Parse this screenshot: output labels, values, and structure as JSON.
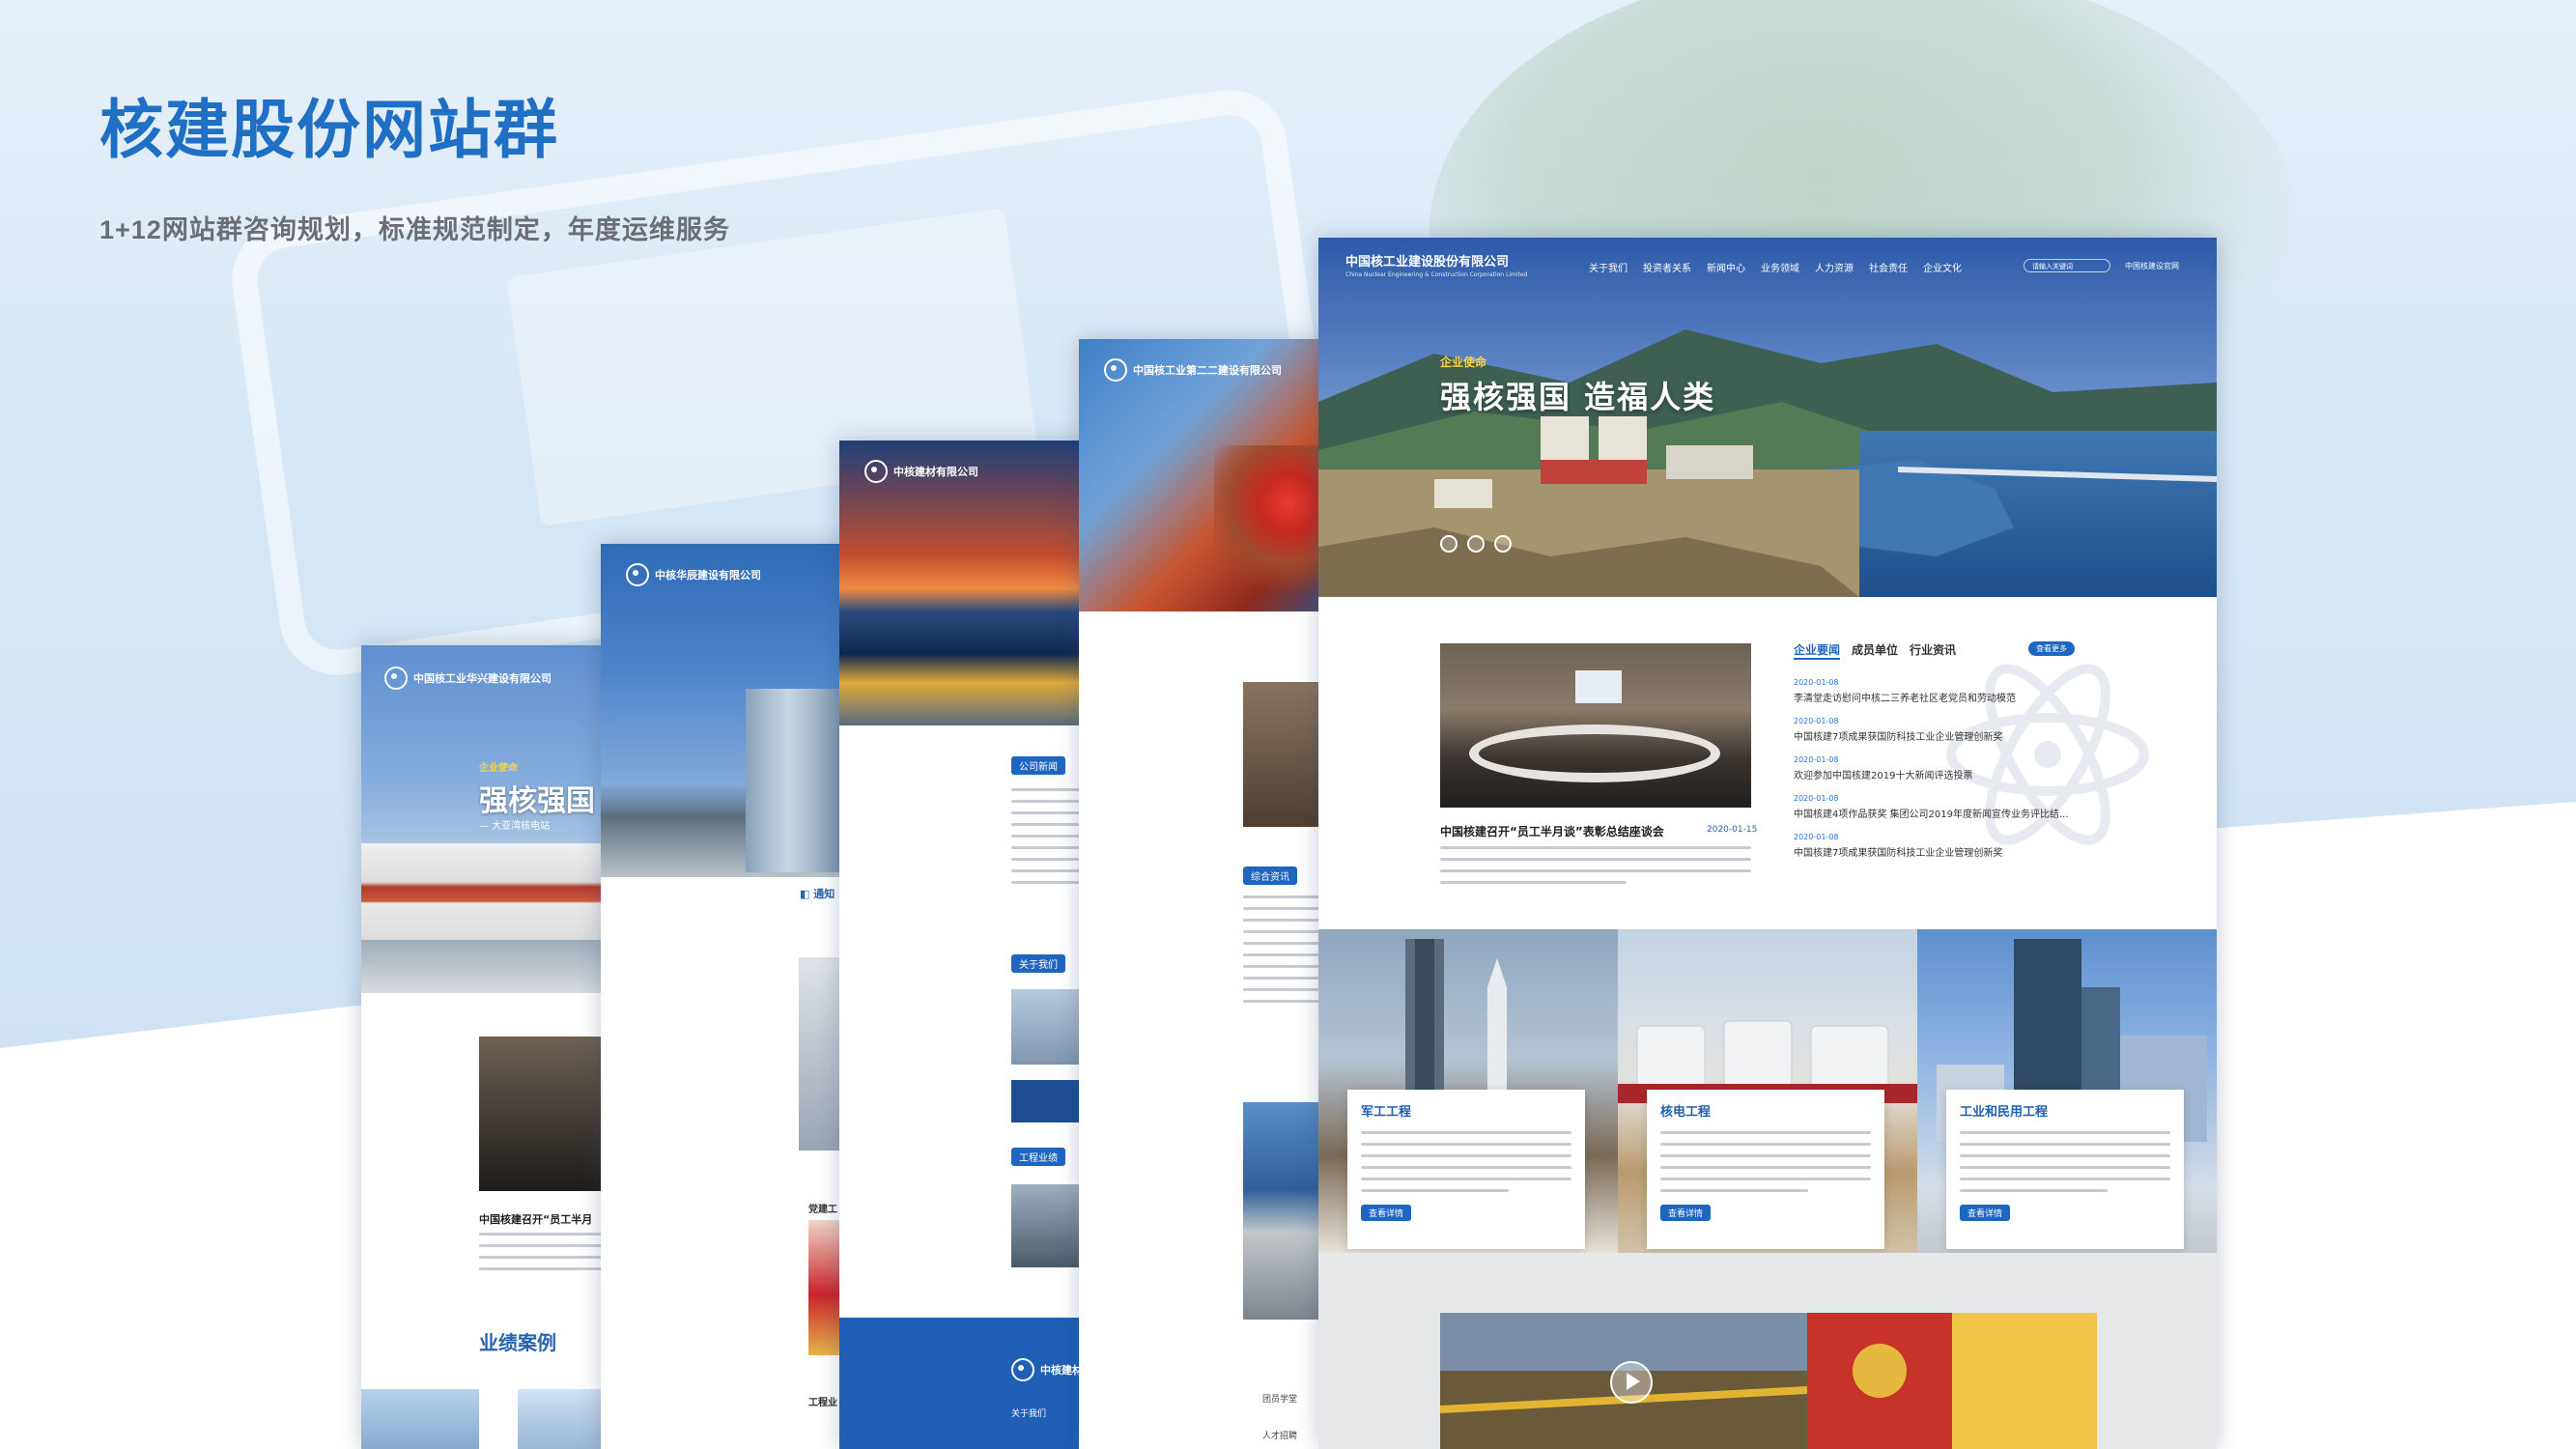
{
  "page": {
    "title": "核建股份网站群",
    "subtitle": "1+12网站群咨询规划，标准规范制定，年度运维服务"
  },
  "sites": {
    "s1": {
      "logo": "中国核工业华兴建设有限公司",
      "slogan_tag": "企业使命",
      "slogan": "强核强国",
      "caption": "— 大亚湾核电站",
      "news_headline": "中国核建召开“员工半月",
      "section_heading": "业绩案例"
    },
    "s2": {
      "logo": "中核华辰建设有限公司",
      "quick_link": "通知",
      "party_label": "党建工",
      "sub_label": "工程业"
    },
    "s3": {
      "logo": "中核建材有限公司",
      "tab_company_news": "公司新闻",
      "tab_about": "关于我们",
      "tab_projects": "工程业绩",
      "footer_logo": "中核建材",
      "footer_about": "关于我们"
    },
    "s4": {
      "logo": "中国核工业第二二建设有限公司",
      "tab_integrated": "综合资讯",
      "footer_item_1": "团员学堂",
      "footer_item_2": "人才招聘"
    },
    "s5": {
      "logo": "中国核工业建设股份有限公司",
      "logo_sub": "China Nuclear Engineering & Construction Corporation Limited",
      "nav": [
        "关于我们",
        "投资者关系",
        "新闻中心",
        "业务领域",
        "人力资源",
        "社会责任",
        "企业文化"
      ],
      "search_placeholder": "请输入关键词",
      "lang": "中国核建设官网",
      "hero_tag": "企业使命",
      "hero_slogan": "强核强国  造福人类",
      "news_headline": "中国核建召开“员工半月谈”表彰总结座谈会",
      "news_date": "2020-01-15",
      "news_tabs": [
        "企业要闻",
        "成员单位",
        "行业资讯"
      ],
      "more": "查看更多",
      "news_list": [
        {
          "date": "2020-01-08",
          "title": "李清堂走访慰问中核二三养老社区老党员和劳动模范"
        },
        {
          "date": "2020-01-08",
          "title": "中国核建7项成果获国防科技工业企业管理创新奖"
        },
        {
          "date": "2020-01-08",
          "title": "欢迎参加中国核建2019十大新闻评选投票"
        },
        {
          "date": "2020-01-08",
          "title": "中国核建4项作品获奖 集团公司2019年度新闻宣传业务评比结..."
        },
        {
          "date": "2020-01-08",
          "title": "中国核建7项成果获国防科技工业企业管理创新奖"
        }
      ],
      "business": [
        {
          "title": "军工工程",
          "more": "查看详情"
        },
        {
          "title": "核电工程",
          "more": "查看详情"
        },
        {
          "title": "工业和民用工程",
          "more": "查看详情"
        }
      ]
    }
  },
  "colors": {
    "brand_blue": "#1f6fc4",
    "accent_yellow": "#ffd23f",
    "subtitle_gray": "#6b6f75"
  }
}
